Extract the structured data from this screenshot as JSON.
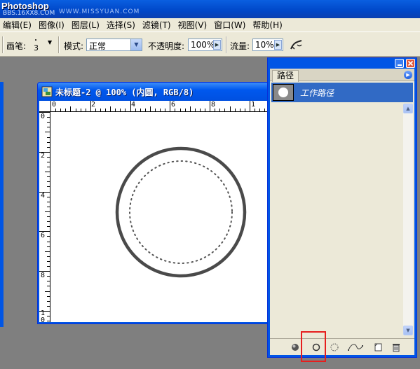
{
  "app": {
    "title": "Photoshop",
    "watermark_forum": "BBS.16XX8.COM",
    "watermark_site": "WWW.MISSYUAN.COM"
  },
  "menu": [
    "编辑(E)",
    "图像(I)",
    "图层(L)",
    "选择(S)",
    "滤镜(T)",
    "视图(V)",
    "窗口(W)",
    "帮助(H)"
  ],
  "options": {
    "brush_label": "画笔:",
    "brush_size": "3",
    "mode_label": "模式:",
    "mode_value": "正常",
    "opacity_label": "不透明度:",
    "opacity_value": "100%",
    "flow_label": "流量:",
    "flow_value": "10%"
  },
  "document": {
    "title": "未标题-2 @ 100% (内圆, RGB/8)",
    "hruler_labels": [
      "0",
      "2",
      "4",
      "6",
      "8",
      "1"
    ],
    "vruler_labels": [
      "0",
      "2",
      "4",
      "6",
      "8",
      "1",
      "0"
    ]
  },
  "paths_panel": {
    "tab": "路径",
    "items": [
      {
        "name": "工作路径",
        "selected": true
      }
    ],
    "footer_icons": [
      "fill-path-icon",
      "stroke-path-icon",
      "load-as-selection-icon",
      "make-work-path-icon",
      "new-path-icon",
      "delete-path-icon"
    ],
    "highlighted": "stroke-path-icon"
  },
  "colors": {
    "xp_blue": "#0055e5",
    "panel_bg": "#ece9d8",
    "selection": "#316ac5",
    "highlight": "#e61e1e",
    "circle_stroke": "#4a4a4a"
  }
}
